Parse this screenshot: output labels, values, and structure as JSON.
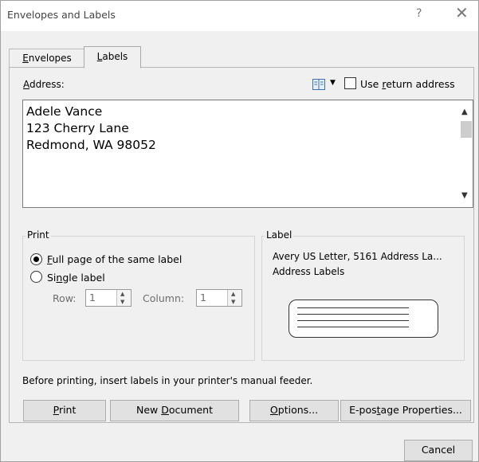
{
  "window": {
    "title": "Envelopes and Labels",
    "help_glyph": "?",
    "close_glyph": "✕"
  },
  "tabs": [
    {
      "mnemonic": "E",
      "rest": "nvelopes",
      "selected": false
    },
    {
      "mnemonic": "L",
      "rest": "abels",
      "selected": true
    }
  ],
  "address": {
    "label_mnemonic": "A",
    "label_rest": "ddress:",
    "text": "Adele Vance\n123 Cherry Lane\nRedmond, WA 98052",
    "address_book_icon": "address-book-icon",
    "use_return_address": {
      "checked": false,
      "label_before": "Use ",
      "label_mnemonic": "r",
      "label_after": "eturn address"
    }
  },
  "print_group": {
    "title": "Print",
    "full_page": {
      "selected": true,
      "mnemonic": "F",
      "rest": "ull page of the same label"
    },
    "single_label": {
      "selected": false,
      "before": "Si",
      "mnemonic": "n",
      "after": "gle label"
    },
    "row": {
      "label": "Row:",
      "value": "1",
      "enabled": false
    },
    "column": {
      "label": "Column:",
      "value": "1",
      "enabled": false
    }
  },
  "label_group": {
    "title": "Label",
    "line1": "Avery US Letter, 5161 Address La...",
    "line2": "Address Labels"
  },
  "feeder_note": "Before printing, insert labels in your printer's manual feeder.",
  "buttons": {
    "print": {
      "mnemonic": "P",
      "rest": "rint"
    },
    "new_document": {
      "before": "New ",
      "mnemonic": "D",
      "after": "ocument"
    },
    "options": {
      "mnemonic": "O",
      "rest": "ptions..."
    },
    "epostage": {
      "before": "E-pos",
      "mnemonic": "t",
      "after": "age Properties..."
    },
    "cancel": "Cancel"
  },
  "colors": {
    "dialog_bg": "#f0f0f0",
    "button_bg": "#e1e1e1",
    "disabled_text": "#6d6d6d"
  }
}
